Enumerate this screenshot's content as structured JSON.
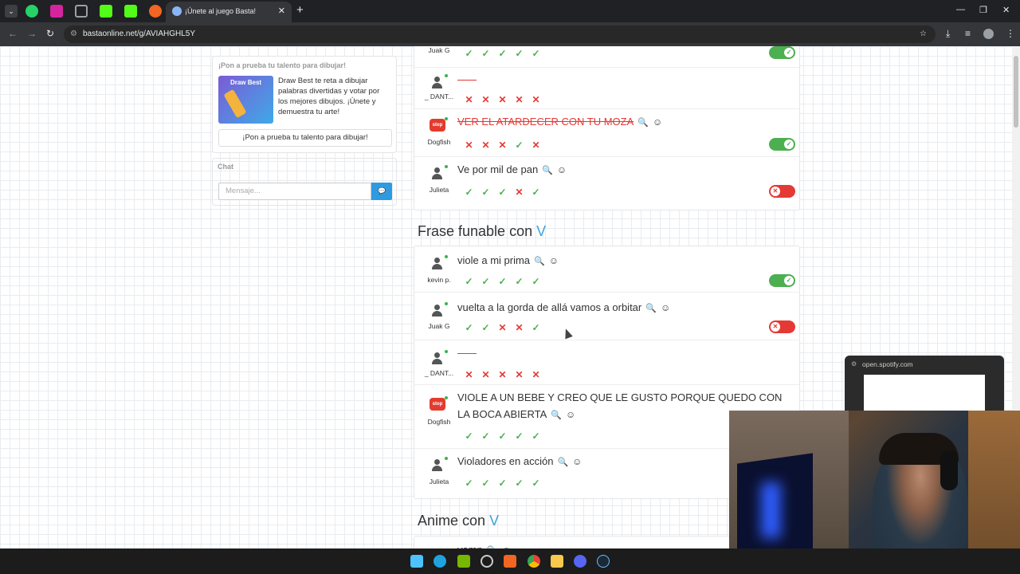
{
  "browser": {
    "tab_title": "¡Únete al juego Basta!",
    "tab_close": "✕",
    "new_tab": "+",
    "url": "bastaonline.net/g/AVIAHGHL5Y",
    "window_controls": [
      "—",
      "❐",
      "✕"
    ],
    "colors": {
      "whatsapp": "#25d366",
      "instagram": "#d6249f",
      "kick": "#53fc18",
      "active_tab": "#35363a"
    }
  },
  "sidebar": {
    "promo": {
      "heading": "¡Pon a prueba tu talento para dibujar!",
      "image_label": "Draw Best",
      "text": "Draw Best te reta a dibujar palabras divertidas y votar por los mejores dibujos. ¡Únete y demuestra tu arte!",
      "button": "¡Pon a prueba tu talento para dibujar!"
    },
    "chat": {
      "heading": "Chat",
      "placeholder": "Mensaje...",
      "send_icon": "💬"
    }
  },
  "icons": {
    "search": "🔍",
    "emoji": "☺",
    "ok": "✓",
    "no": "✕",
    "stop": "stop"
  },
  "section1": {
    "rows": [
      {
        "player": "Juak G",
        "answer": "",
        "votes": [
          "ok",
          "ok",
          "ok",
          "ok",
          "ok"
        ],
        "toggle": "on"
      },
      {
        "player": "_ DANT...",
        "answer": "",
        "blank": true,
        "votes": [
          "no",
          "no",
          "no",
          "no",
          "no"
        ]
      },
      {
        "player": "Dogfish",
        "answer": "VER EL ATARDECER CON TU MOZA",
        "struck": true,
        "votes": [
          "no",
          "no",
          "no",
          "ok",
          "no"
        ],
        "toggle": "on"
      },
      {
        "player": "Julieta",
        "answer": "Ve por mil de pan",
        "votes": [
          "ok",
          "ok",
          "ok",
          "no",
          "ok"
        ],
        "toggle": "off"
      }
    ]
  },
  "section2": {
    "title": "Frase funable con",
    "letter": "V",
    "rows": [
      {
        "player": "kevin p.",
        "answer": "viole a mi prima",
        "votes": [
          "ok",
          "ok",
          "ok",
          "ok",
          "ok"
        ],
        "toggle": "on"
      },
      {
        "player": "Juak G",
        "answer": "vuelta a la gorda de allá vamos a orbitar",
        "votes": [
          "ok",
          "ok",
          "no",
          "no",
          "ok"
        ],
        "toggle": "off"
      },
      {
        "player": "_ DANT...",
        "answer": "",
        "blank": true,
        "votes": [
          "no",
          "no",
          "no",
          "no",
          "no"
        ]
      },
      {
        "player": "Dogfish",
        "answer": "VIOLE A UN BEBE Y CREO QUE LE GUSTO PORQUE QUEDO CON LA BOCA ABIERTA",
        "votes": [
          "ok",
          "ok",
          "ok",
          "ok",
          "ok"
        ]
      },
      {
        "player": "Julieta",
        "answer": "Violadores en acción",
        "votes": [
          "ok",
          "ok",
          "ok",
          "ok",
          "ok"
        ]
      }
    ]
  },
  "section3": {
    "title": "Anime con",
    "letter": "V",
    "partial_answer": "vamp"
  },
  "overlay": {
    "spotify_url": "open.spotify.com"
  }
}
